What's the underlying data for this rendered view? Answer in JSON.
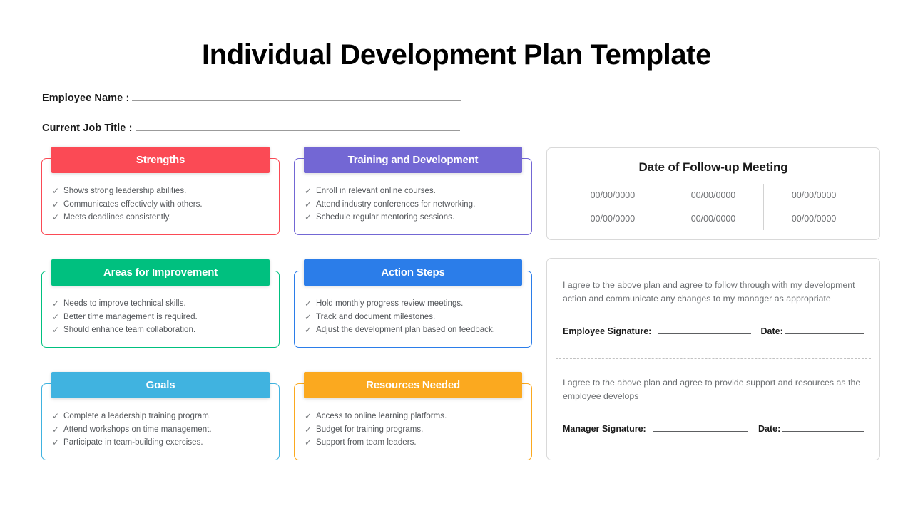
{
  "page": {
    "title": "Individual Development Plan Template"
  },
  "fields": [
    {
      "label": "Employee Name :",
      "value": ""
    },
    {
      "label": "Current Job Title :",
      "value": ""
    }
  ],
  "colors": {
    "strengths": "#fb4a55",
    "training": "#7367d4",
    "areas": "#00c07f",
    "action": "#2b7de9",
    "goals": "#40b3e0",
    "resources": "#fba91f"
  },
  "cards": [
    {
      "id": "strengths",
      "title": "Strengths",
      "color": "#fb4a55",
      "items": [
        "Shows strong leadership abilities.",
        "Communicates effectively with others.",
        "Meets deadlines consistently."
      ]
    },
    {
      "id": "training",
      "title": "Training and Development",
      "color": "#7367d4",
      "items": [
        "Enroll in relevant online courses.",
        "Attend industry conferences for networking.",
        "Schedule regular mentoring sessions."
      ]
    },
    {
      "id": "areas",
      "title": "Areas for Improvement",
      "color": "#00c07f",
      "items": [
        "Needs to improve technical skills.",
        "Better time management is required.",
        "Should enhance team collaboration."
      ]
    },
    {
      "id": "action",
      "title": "Action Steps",
      "color": "#2b7de9",
      "items": [
        "Hold monthly progress review meetings.",
        "Track and document milestones.",
        "Adjust the development plan based on feedback."
      ]
    },
    {
      "id": "goals",
      "title": "Goals",
      "color": "#40b3e0",
      "items": [
        "Complete a leadership training program.",
        "Attend workshops on time management.",
        "Participate in team-building exercises."
      ]
    },
    {
      "id": "resources",
      "title": "Resources Needed",
      "color": "#fba91f",
      "items": [
        "Access to online learning platforms.",
        "Budget for training programs.",
        "Support from team leaders."
      ]
    }
  ],
  "followup": {
    "title": "Date of Follow-up Meeting",
    "rows": [
      [
        "00/00/0000",
        "00/00/0000",
        "00/00/0000"
      ],
      [
        "00/00/0000",
        "00/00/0000",
        "00/00/0000"
      ]
    ]
  },
  "signatures": {
    "employee": {
      "statement": "I agree to the above plan and agree to follow through with my development action and communicate any changes to my manager as appropriate",
      "signature_label": "Employee Signature:",
      "date_label": "Date:",
      "signature_value": "",
      "date_value": ""
    },
    "manager": {
      "statement": "I agree to the above plan and agree to provide support and resources as the employee develops",
      "signature_label": "Manager Signature:",
      "date_label": "Date:",
      "signature_value": "",
      "date_value": ""
    }
  },
  "icons": {
    "check": "✓"
  }
}
